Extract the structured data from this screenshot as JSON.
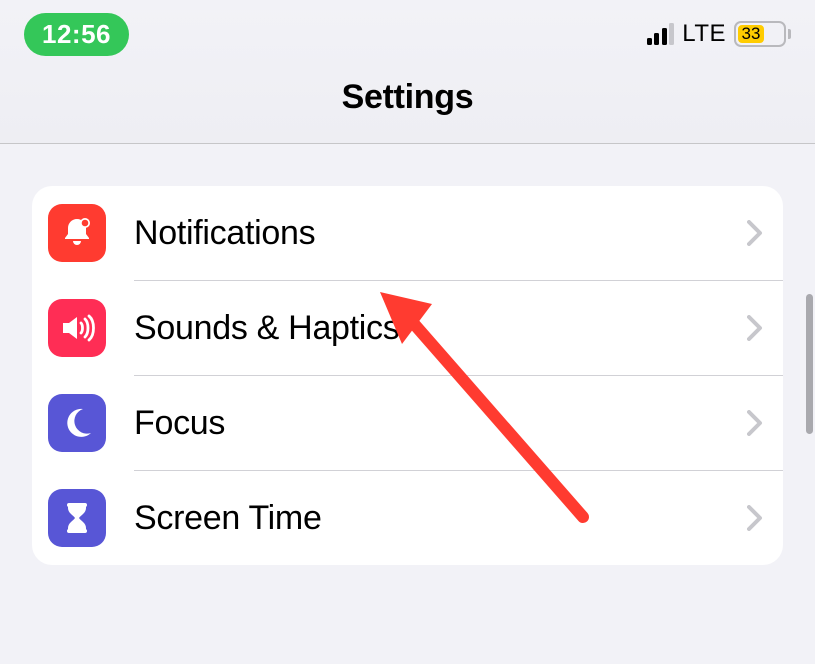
{
  "status_bar": {
    "time": "12:56",
    "network_type": "LTE",
    "battery_percent": "33"
  },
  "header": {
    "title": "Settings"
  },
  "settings": {
    "rows": [
      {
        "label": "Notifications",
        "icon": "bell-badge-icon",
        "color": "icon-red"
      },
      {
        "label": "Sounds & Haptics",
        "icon": "speaker-icon",
        "color": "icon-pink"
      },
      {
        "label": "Focus",
        "icon": "moon-icon",
        "color": "icon-indigo1"
      },
      {
        "label": "Screen Time",
        "icon": "hourglass-icon",
        "color": "icon-indigo2"
      }
    ]
  }
}
